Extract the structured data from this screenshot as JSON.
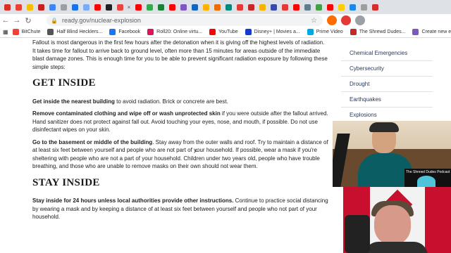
{
  "browser": {
    "tab_colors": [
      "#d93025",
      "#ea4335",
      "#fbbc04",
      "#c5221f",
      "#4285f4",
      "#9aa0a6",
      "#1a73e8",
      "#7baaf7",
      "#ff0000",
      "#202124",
      "#e8453c",
      "#ff0000",
      "#34a853",
      "#188038",
      "#ff0000",
      "#7e57c2",
      "#1565c0",
      "#ffb300",
      "#ef6c00",
      "#00897b",
      "#e53935",
      "#c62828",
      "#f4b400",
      "#3949ab",
      "#e53935",
      "#ff0000",
      "#607d8b",
      "#43a047",
      "#ff0000",
      "#ffcc00",
      "#1e88e5",
      "#9e9e9e",
      "#d32f2f"
    ],
    "url": "ready.gov/nuclear-explosion",
    "extension_colors": [
      "#ff6d00",
      "#e53935",
      "#9aa0a6"
    ]
  },
  "bookmarks": [
    {
      "label": "BitChute",
      "color": "#ef4136"
    },
    {
      "label": "Half Blind Hecklers...",
      "color": "#555555"
    },
    {
      "label": "Facebook",
      "color": "#1877f2"
    },
    {
      "label": "Roll20: Online virtu...",
      "color": "#e0115f"
    },
    {
      "label": "YouTube",
      "color": "#ff0000"
    },
    {
      "label": "Disney+ | Movies a...",
      "color": "#113ccf"
    },
    {
      "label": "Prime Video",
      "color": "#00a8e1"
    },
    {
      "label": "The Shrewd Dudes...",
      "color": "#c62828"
    },
    {
      "label": "Create new episode...",
      "color": "#7e57c2"
    }
  ],
  "article": {
    "intro": "Fallout is most dangerous in the first few hours after the detonation when it is giving off the highest levels of radiation. It takes time for fallout to arrive back to ground level, often more than 15 minutes for areas outside of the immediate blast damage zones. This is enough time for you to be able to prevent significant radiation exposure by following these simple steps:",
    "heading1": "GET INSIDE",
    "p1_bold": "Get inside the nearest building",
    "p1_text": " to avoid radiation. Brick or concrete are best.",
    "p2_bold": "Remove contaminated clothing and wipe off or wash unprotected skin",
    "p2_text": " if you were outside after the fallout arrived. Hand sanitizer does not protect against fall out. Avoid touching your eyes, nose, and mouth, if possible. Do not use disinfectant wipes on your skin.",
    "p3_bold": "Go to the basement or middle of the building",
    "p3_text": ". Stay away from the outer walls and roof. Try to maintain a distance of at least six feet between yourself and people who are not part of your household. If possible, wear a mask if you're sheltering with people who are not a part of your household. Children under two years old, people who have trouble breathing, and those who are unable to remove masks on their own should not wear them.",
    "heading2": "STAY INSIDE",
    "p4_bold": "Stay inside for 24 hours unless local authorities provide other instructions.",
    "p4_text": " Continue to practice social distancing by wearing a mask and by keeping a distance of at least six feet between yourself and people who not part of your household."
  },
  "sidebar": {
    "items": [
      "Chemical Emergencies",
      "Cybersecurity",
      "Drought",
      "Earthquakes",
      "Explosions"
    ]
  },
  "webcam": {
    "logo_text": "The Shrewd Dudes Podcast"
  }
}
